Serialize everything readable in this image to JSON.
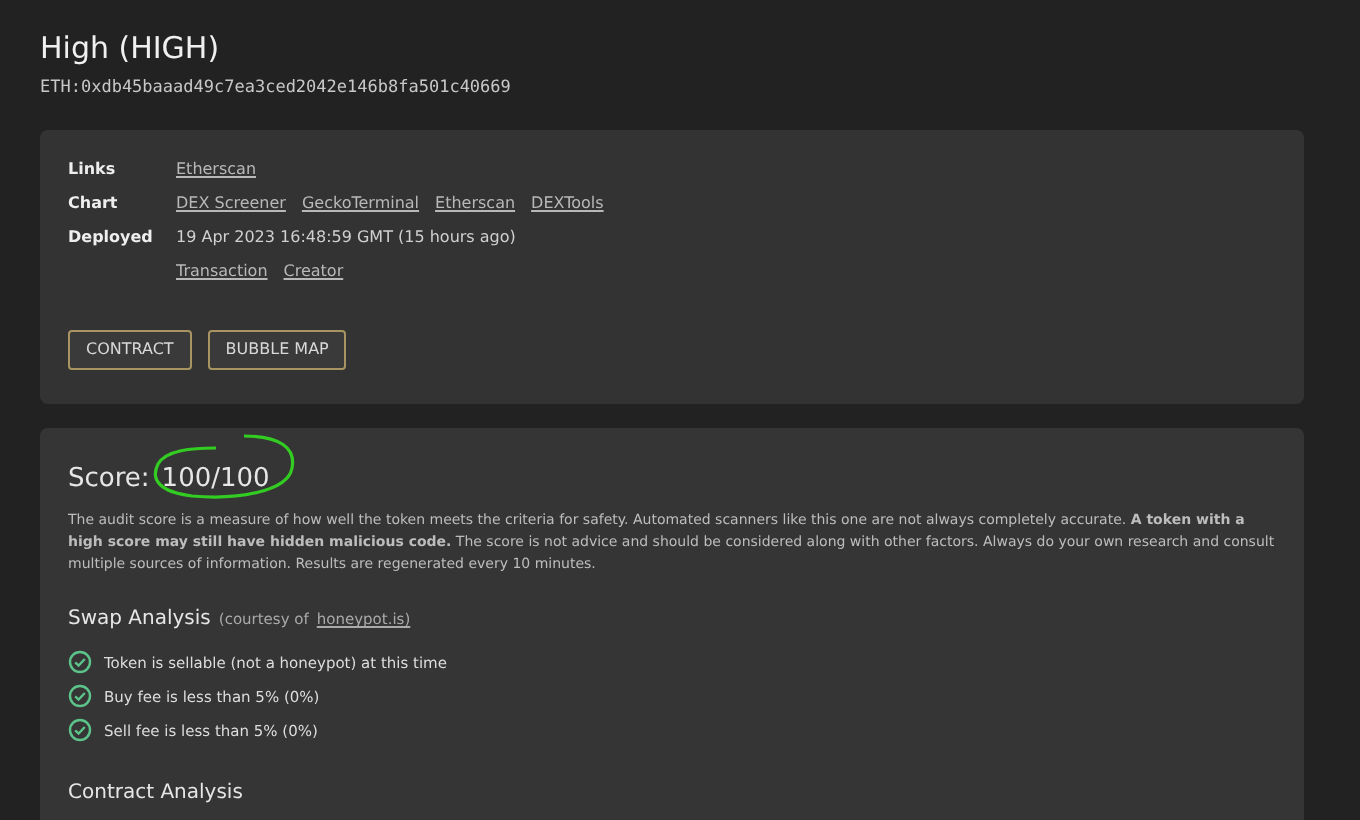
{
  "title": "High (HIGH)",
  "address": "ETH:0xdb45baaad49c7ea3ced2042e146b8fa501c40669",
  "info": [
    {
      "label": "Links",
      "links": [
        "Etherscan"
      ]
    },
    {
      "label": "Chart",
      "links": [
        "DEX Screener",
        "GeckoTerminal",
        "Etherscan",
        "DEXTools"
      ]
    },
    {
      "label": "Deployed",
      "text": "19 Apr 2023 16:48:59 GMT (15 hours ago)",
      "links": [
        "Transaction",
        "Creator"
      ]
    }
  ],
  "buttons": [
    "CONTRACT",
    "BUBBLE MAP"
  ],
  "score": {
    "label": "Score:",
    "value": "100/100",
    "description": "The audit score is a measure of how well the token meets the criteria for safety.  Automated scanners like this one are not always completely accurate.  **A token with a high score may still have hidden malicious code.** The score is not advice and should be considered along with other factors. Always do your own research and consult multiple sources of information.  Results are regenerated every 10 minutes."
  },
  "swap_analysis": {
    "title": "Swap Analysis",
    "credit": "(courtesy of",
    "credit_link": "honeypot.is)",
    "checks": [
      {
        "text": "Token is sellable (not a honeypot) at this time",
        "passed": true
      },
      {
        "text": "Buy fee is less than 5% (0%)",
        "passed": true
      },
      {
        "text": "Sell fee is less than 5% (0%)",
        "passed": true
      }
    ]
  },
  "contract_analysis": {
    "title": "Contract Analysis"
  }
}
